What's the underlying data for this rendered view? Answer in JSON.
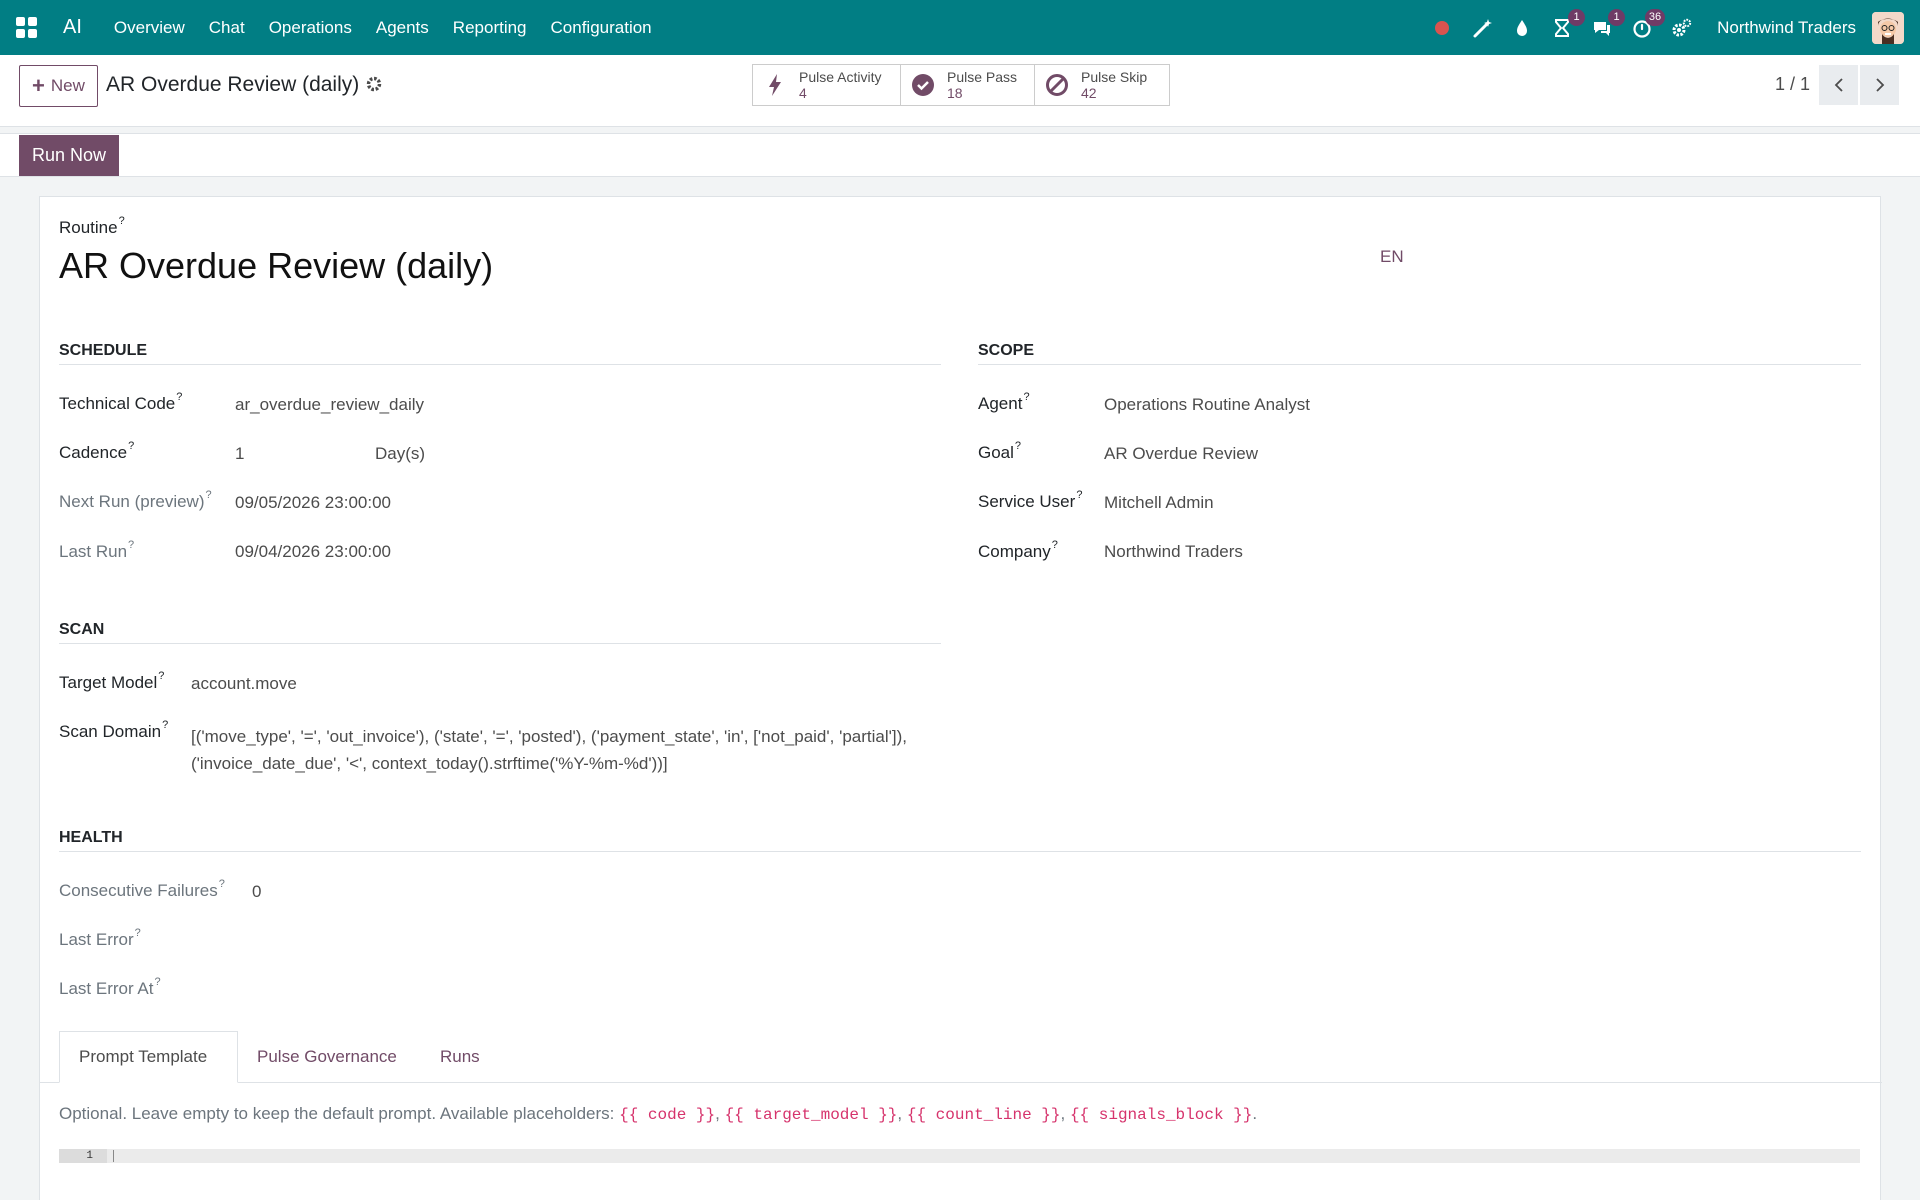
{
  "navbar": {
    "brand": "AI",
    "menu": [
      "Overview",
      "Chat",
      "Operations",
      "Agents",
      "Reporting",
      "Configuration"
    ],
    "badges": {
      "activities": "1",
      "messages": "1",
      "timer": "36"
    },
    "company": "Northwind Traders"
  },
  "control": {
    "new_label": "New",
    "title": "AR Overdue Review (daily)",
    "smart_buttons": [
      {
        "label": "Pulse Activity",
        "value": "4"
      },
      {
        "label": "Pulse Pass",
        "value": "18"
      },
      {
        "label": "Pulse Skip",
        "value": "42"
      }
    ],
    "pager": "1 / 1"
  },
  "status": {
    "run_label": "Run Now"
  },
  "form": {
    "routine_label": "Routine",
    "routine_name": "AR Overdue Review (daily)",
    "lang": "EN",
    "schedule": {
      "title": "SCHEDULE",
      "technical_code_label": "Technical Code",
      "technical_code": "ar_overdue_review_daily",
      "cadence_label": "Cadence",
      "cadence_value": "1",
      "cadence_unit": "Day(s)",
      "next_run_label": "Next Run (preview)",
      "next_run": "09/05/2026 23:00:00",
      "last_run_label": "Last Run",
      "last_run": "09/04/2026 23:00:00"
    },
    "scope": {
      "title": "SCOPE",
      "agent_label": "Agent",
      "agent": "Operations Routine Analyst",
      "goal_label": "Goal",
      "goal": "AR Overdue Review",
      "service_user_label": "Service User",
      "service_user": "Mitchell Admin",
      "company_label": "Company",
      "company": "Northwind Traders"
    },
    "scan": {
      "title": "SCAN",
      "target_model_label": "Target Model",
      "target_model": "account.move",
      "scan_domain_label": "Scan Domain",
      "scan_domain_line1": "[('move_type', '=', 'out_invoice'), ('state', '=', 'posted'), ('payment_state', 'in', ['not_paid', 'partial']),",
      "scan_domain_line2": "('invoice_date_due', '<', context_today().strftime('%Y-%m-%d'))]"
    },
    "health": {
      "title": "HEALTH",
      "consecutive_failures_label": "Consecutive Failures",
      "consecutive_failures": "0",
      "last_error_label": "Last Error",
      "last_error_at_label": "Last Error At"
    },
    "tabs": [
      "Prompt Template",
      "Pulse Governance",
      "Runs"
    ],
    "prompt": {
      "help_prefix": "Optional. Leave empty to keep the default prompt. Available placeholders: ",
      "placeholders": [
        "{{ code }}",
        "{{ target_model }}",
        "{{ count_line }}",
        "{{ signals_block }}"
      ],
      "line_number": "1"
    }
  }
}
